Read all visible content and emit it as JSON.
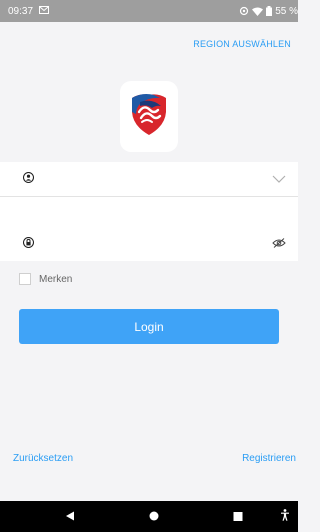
{
  "status_bar": {
    "time": "09:37",
    "battery": "55 %"
  },
  "header": {
    "region_link": "REGION AUSWÄHLEN"
  },
  "logo": {
    "icon": "shield-logo-icon",
    "colors": {
      "red": "#d8262c",
      "blue": "#1f5aa6",
      "dark_blue": "#1b3a7a"
    }
  },
  "form": {
    "username": {
      "value": "",
      "icon": "user-icon",
      "trail_icon": "chevron-down-icon"
    },
    "password": {
      "value": "",
      "icon": "lock-icon",
      "trail_icon": "eye-off-icon"
    },
    "remember": {
      "label": "Merken",
      "checked": false
    },
    "login_button": "Login"
  },
  "footer": {
    "reset_link": "Zurücksetzen",
    "register_link": "Registrieren"
  },
  "colors": {
    "accent": "#2a9df4",
    "button": "#3fa3f7",
    "background": "#f4f4f6"
  }
}
